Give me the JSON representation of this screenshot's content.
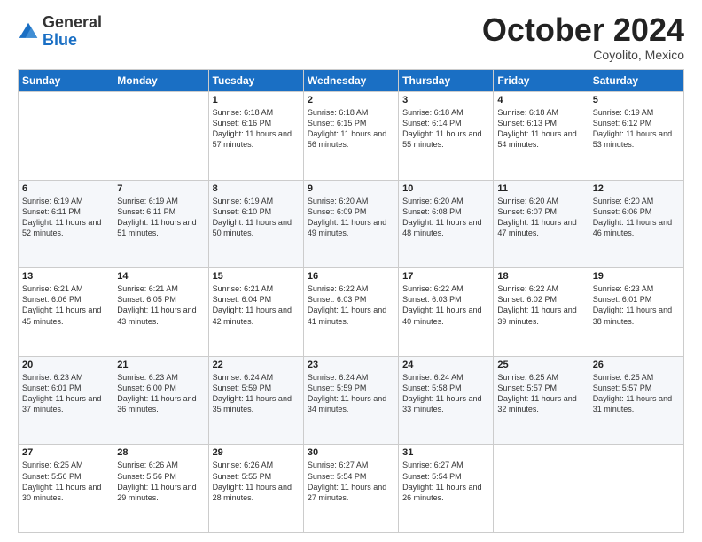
{
  "header": {
    "logo_general": "General",
    "logo_blue": "Blue",
    "month_title": "October 2024",
    "location": "Coyolito, Mexico"
  },
  "days_of_week": [
    "Sunday",
    "Monday",
    "Tuesday",
    "Wednesday",
    "Thursday",
    "Friday",
    "Saturday"
  ],
  "weeks": [
    [
      {
        "day": "",
        "content": ""
      },
      {
        "day": "",
        "content": ""
      },
      {
        "day": "1",
        "content": "Sunrise: 6:18 AM\nSunset: 6:16 PM\nDaylight: 11 hours and 57 minutes."
      },
      {
        "day": "2",
        "content": "Sunrise: 6:18 AM\nSunset: 6:15 PM\nDaylight: 11 hours and 56 minutes."
      },
      {
        "day": "3",
        "content": "Sunrise: 6:18 AM\nSunset: 6:14 PM\nDaylight: 11 hours and 55 minutes."
      },
      {
        "day": "4",
        "content": "Sunrise: 6:18 AM\nSunset: 6:13 PM\nDaylight: 11 hours and 54 minutes."
      },
      {
        "day": "5",
        "content": "Sunrise: 6:19 AM\nSunset: 6:12 PM\nDaylight: 11 hours and 53 minutes."
      }
    ],
    [
      {
        "day": "6",
        "content": "Sunrise: 6:19 AM\nSunset: 6:11 PM\nDaylight: 11 hours and 52 minutes."
      },
      {
        "day": "7",
        "content": "Sunrise: 6:19 AM\nSunset: 6:11 PM\nDaylight: 11 hours and 51 minutes."
      },
      {
        "day": "8",
        "content": "Sunrise: 6:19 AM\nSunset: 6:10 PM\nDaylight: 11 hours and 50 minutes."
      },
      {
        "day": "9",
        "content": "Sunrise: 6:20 AM\nSunset: 6:09 PM\nDaylight: 11 hours and 49 minutes."
      },
      {
        "day": "10",
        "content": "Sunrise: 6:20 AM\nSunset: 6:08 PM\nDaylight: 11 hours and 48 minutes."
      },
      {
        "day": "11",
        "content": "Sunrise: 6:20 AM\nSunset: 6:07 PM\nDaylight: 11 hours and 47 minutes."
      },
      {
        "day": "12",
        "content": "Sunrise: 6:20 AM\nSunset: 6:06 PM\nDaylight: 11 hours and 46 minutes."
      }
    ],
    [
      {
        "day": "13",
        "content": "Sunrise: 6:21 AM\nSunset: 6:06 PM\nDaylight: 11 hours and 45 minutes."
      },
      {
        "day": "14",
        "content": "Sunrise: 6:21 AM\nSunset: 6:05 PM\nDaylight: 11 hours and 43 minutes."
      },
      {
        "day": "15",
        "content": "Sunrise: 6:21 AM\nSunset: 6:04 PM\nDaylight: 11 hours and 42 minutes."
      },
      {
        "day": "16",
        "content": "Sunrise: 6:22 AM\nSunset: 6:03 PM\nDaylight: 11 hours and 41 minutes."
      },
      {
        "day": "17",
        "content": "Sunrise: 6:22 AM\nSunset: 6:03 PM\nDaylight: 11 hours and 40 minutes."
      },
      {
        "day": "18",
        "content": "Sunrise: 6:22 AM\nSunset: 6:02 PM\nDaylight: 11 hours and 39 minutes."
      },
      {
        "day": "19",
        "content": "Sunrise: 6:23 AM\nSunset: 6:01 PM\nDaylight: 11 hours and 38 minutes."
      }
    ],
    [
      {
        "day": "20",
        "content": "Sunrise: 6:23 AM\nSunset: 6:01 PM\nDaylight: 11 hours and 37 minutes."
      },
      {
        "day": "21",
        "content": "Sunrise: 6:23 AM\nSunset: 6:00 PM\nDaylight: 11 hours and 36 minutes."
      },
      {
        "day": "22",
        "content": "Sunrise: 6:24 AM\nSunset: 5:59 PM\nDaylight: 11 hours and 35 minutes."
      },
      {
        "day": "23",
        "content": "Sunrise: 6:24 AM\nSunset: 5:59 PM\nDaylight: 11 hours and 34 minutes."
      },
      {
        "day": "24",
        "content": "Sunrise: 6:24 AM\nSunset: 5:58 PM\nDaylight: 11 hours and 33 minutes."
      },
      {
        "day": "25",
        "content": "Sunrise: 6:25 AM\nSunset: 5:57 PM\nDaylight: 11 hours and 32 minutes."
      },
      {
        "day": "26",
        "content": "Sunrise: 6:25 AM\nSunset: 5:57 PM\nDaylight: 11 hours and 31 minutes."
      }
    ],
    [
      {
        "day": "27",
        "content": "Sunrise: 6:25 AM\nSunset: 5:56 PM\nDaylight: 11 hours and 30 minutes."
      },
      {
        "day": "28",
        "content": "Sunrise: 6:26 AM\nSunset: 5:56 PM\nDaylight: 11 hours and 29 minutes."
      },
      {
        "day": "29",
        "content": "Sunrise: 6:26 AM\nSunset: 5:55 PM\nDaylight: 11 hours and 28 minutes."
      },
      {
        "day": "30",
        "content": "Sunrise: 6:27 AM\nSunset: 5:54 PM\nDaylight: 11 hours and 27 minutes."
      },
      {
        "day": "31",
        "content": "Sunrise: 6:27 AM\nSunset: 5:54 PM\nDaylight: 11 hours and 26 minutes."
      },
      {
        "day": "",
        "content": ""
      },
      {
        "day": "",
        "content": ""
      }
    ]
  ]
}
